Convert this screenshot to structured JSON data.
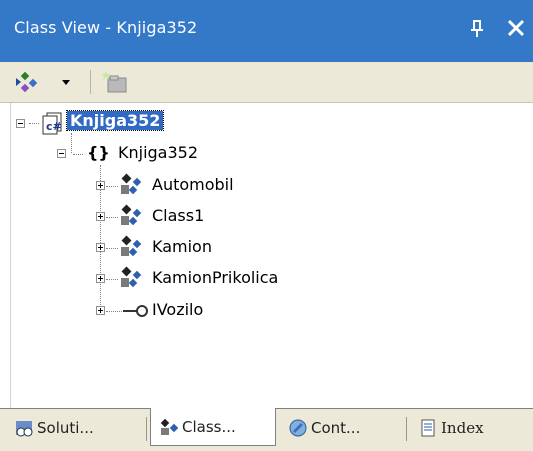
{
  "window": {
    "title": "Class View - Knjiga352"
  },
  "toolbar": {
    "sort_icon": "sort-by-icon",
    "new_folder_icon": "new-folder-icon"
  },
  "tree": {
    "project": {
      "label": "Knjiga352"
    },
    "namespace": {
      "braces": "{}",
      "label": "Knjiga352"
    },
    "classes": [
      {
        "label": "Automobil"
      },
      {
        "label": "Class1"
      },
      {
        "label": "Kamion"
      },
      {
        "label": "KamionPrikolica"
      }
    ],
    "interface": {
      "label": "IVozilo"
    }
  },
  "tabs": [
    {
      "label": "Soluti...",
      "icon": "solution-explorer-icon"
    },
    {
      "label": "Class...",
      "icon": "class-view-icon"
    },
    {
      "label": "Cont...",
      "icon": "contents-icon"
    },
    {
      "label": "Index",
      "icon": "index-icon"
    }
  ],
  "colors": {
    "titlebar": "#3478c8",
    "selection": "#316ac5",
    "chrome": "#ece9d8"
  }
}
